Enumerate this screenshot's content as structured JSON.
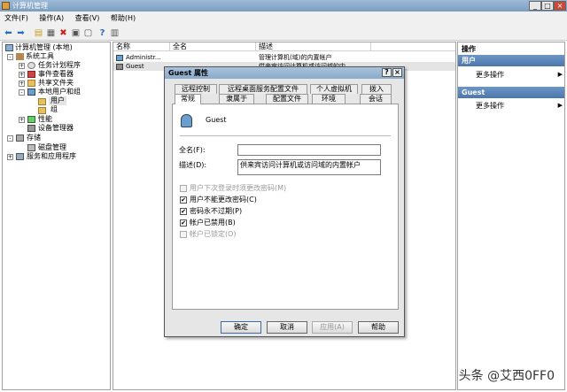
{
  "window": {
    "title": "计算机管理",
    "min": "_",
    "max": "□",
    "close": "×"
  },
  "menu": [
    "文件(F)",
    "操作(A)",
    "查看(V)",
    "帮助(H)"
  ],
  "tree": [
    {
      "label": "计算机管理 (本地)",
      "icon": "computer-icon"
    },
    {
      "label": "系统工具",
      "icon": "tools-icon",
      "exp": "-"
    },
    {
      "label": "任务计划程序",
      "icon": "clock-icon",
      "exp": "+"
    },
    {
      "label": "事件查看器",
      "icon": "event-icon",
      "exp": "+"
    },
    {
      "label": "共享文件夹",
      "icon": "folder-icon",
      "exp": "+"
    },
    {
      "label": "本地用户和组",
      "icon": "users-icon",
      "exp": "-"
    },
    {
      "label": "用户",
      "icon": "folder-icon"
    },
    {
      "label": "组",
      "icon": "folder-icon"
    },
    {
      "label": "性能",
      "icon": "performance-icon",
      "exp": "+"
    },
    {
      "label": "设备管理器",
      "icon": "device-icon"
    },
    {
      "label": "存储",
      "icon": "storage-icon",
      "exp": "-"
    },
    {
      "label": "磁盘管理",
      "icon": "disk-icon"
    },
    {
      "label": "服务和应用程序",
      "icon": "services-icon",
      "exp": "+"
    }
  ],
  "list": {
    "headers": [
      "名称",
      "全名",
      "描述"
    ],
    "rows": [
      {
        "name": "Administr...",
        "fullname": "",
        "desc": "管理计算机(域)的内置帐户"
      },
      {
        "name": "Guest",
        "fullname": "",
        "desc": "供来宾访问计算机或访问域的内"
      }
    ]
  },
  "actions": {
    "title": "操作",
    "sections": [
      {
        "header": "用户",
        "item": "更多操作"
      },
      {
        "header": "Guest",
        "item": "更多操作"
      }
    ]
  },
  "dialog": {
    "title": "Guest 属性",
    "help": "?",
    "close": "×",
    "tabs_back": [
      "远程控制",
      "远程桌面服务配置文件",
      "个人虚拟机",
      "拨入"
    ],
    "tabs_front": [
      "常规",
      "隶属于",
      "配置文件",
      "环境",
      "会话"
    ],
    "username": "Guest",
    "fullname_label": "全名(F):",
    "fullname_value": "",
    "desc_label": "描述(D):",
    "desc_value": "供来宾访问计算机或访问域的内置帐户",
    "checkboxes": [
      {
        "label": "用户下次登录时须更改密码(M)",
        "checked": false,
        "disabled": true
      },
      {
        "label": "用户不能更改密码(C)",
        "checked": true,
        "disabled": false
      },
      {
        "label": "密码永不过期(P)",
        "checked": true,
        "disabled": false
      },
      {
        "label": "帐户已禁用(B)",
        "checked": true,
        "disabled": false
      },
      {
        "label": "帐户已锁定(O)",
        "checked": false,
        "disabled": true
      }
    ],
    "buttons": {
      "ok": "确定",
      "cancel": "取消",
      "apply": "应用(A)",
      "help": "帮助"
    }
  },
  "watermark": "头条 @艾西0FF0"
}
